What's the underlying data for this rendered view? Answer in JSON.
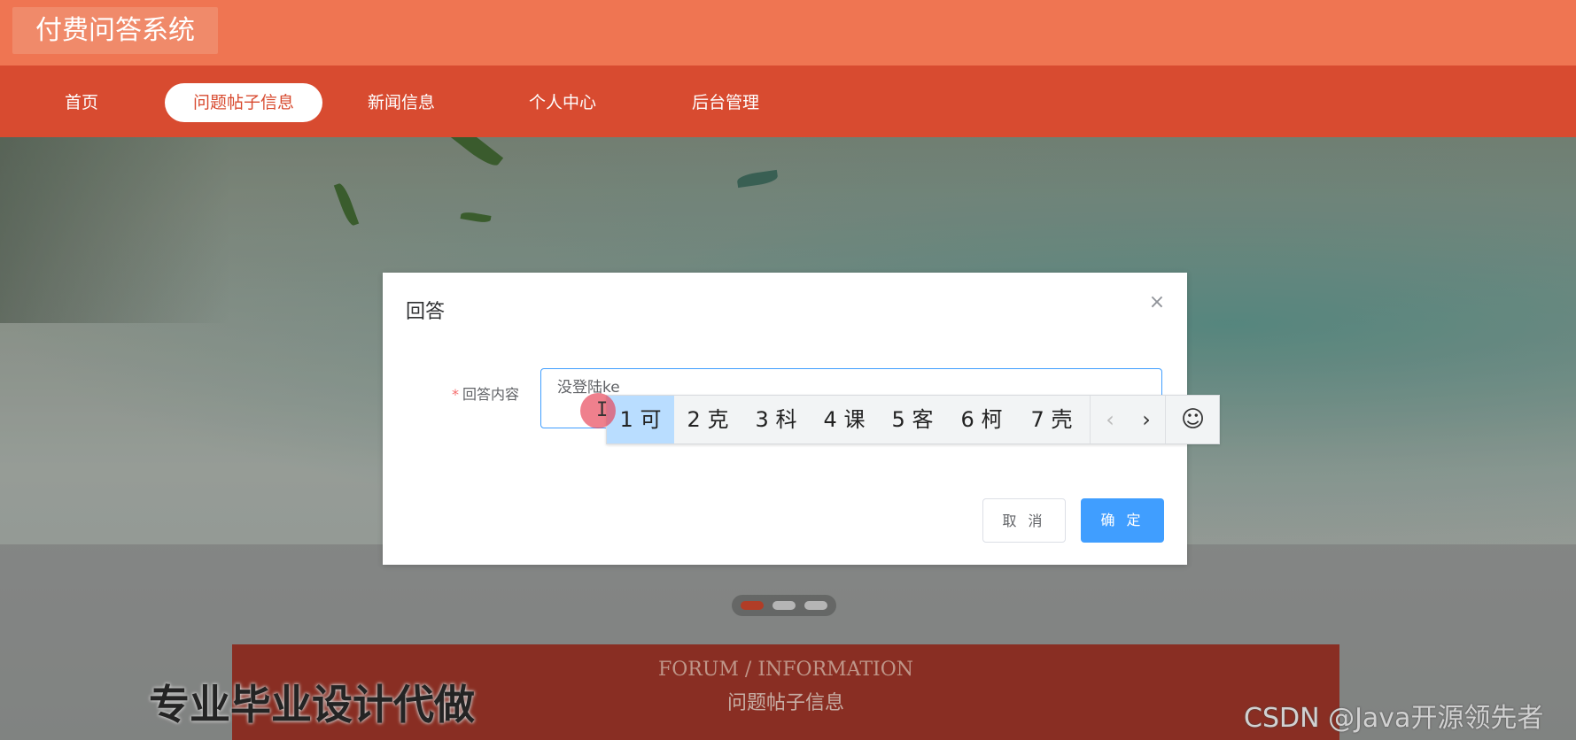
{
  "site": {
    "title": "付费问答系统"
  },
  "nav": {
    "items": [
      {
        "label": "首页",
        "active": false
      },
      {
        "label": "问题帖子信息",
        "active": true
      },
      {
        "label": "新闻信息",
        "active": false
      },
      {
        "label": "个人中心",
        "active": false
      },
      {
        "label": "后台管理",
        "active": false
      }
    ]
  },
  "banner": {
    "en": "FORUM / INFORMATION",
    "cn": "问题帖子信息"
  },
  "carousel": {
    "dot_count": 3,
    "active_index": 0
  },
  "dialog": {
    "title": "回答",
    "close_icon": "close-icon",
    "field_label": "回答内容",
    "required_mark": "*",
    "answer_value": "没登陆ke",
    "cancel_label": "取 消",
    "ok_label": "确 定"
  },
  "ime": {
    "candidates": [
      "1 可",
      "2 克",
      "3 科",
      "4 课",
      "5 客",
      "6 柯",
      "7 壳"
    ],
    "active_index": 0,
    "prev": "‹",
    "next": "›",
    "emoji": "☺"
  },
  "watermarks": {
    "left": "专业毕业设计代做",
    "right": "CSDN @Java开源领先者"
  },
  "colors": {
    "header": "#ef7552",
    "nav": "#d84b30",
    "primary": "#409eff",
    "banner": "#a8392b"
  }
}
